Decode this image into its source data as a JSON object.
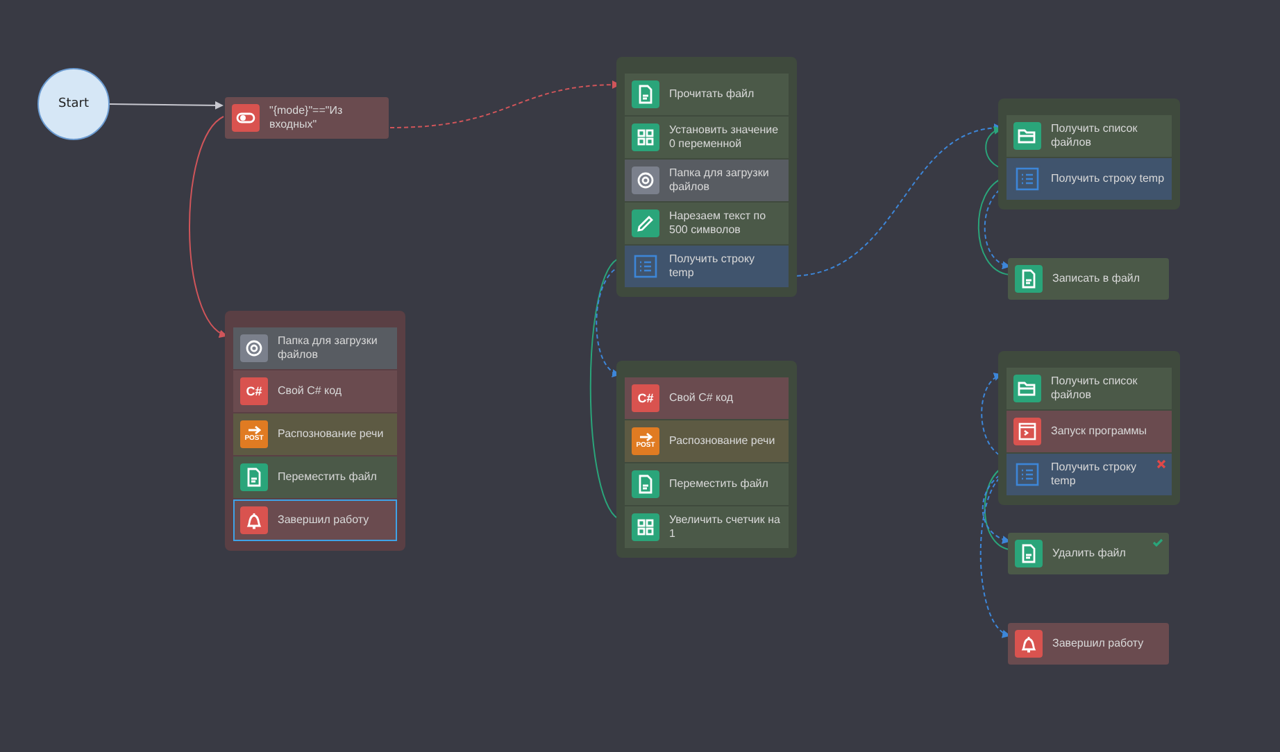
{
  "start": {
    "label": "Start"
  },
  "blocks": [
    {
      "kind": "single",
      "items": [
        {
          "kind": "toggle",
          "label": "\"{mode}\"==\"Из входных\"",
          "selected": false
        }
      ]
    },
    {
      "kind": "group",
      "color": "#5a3f44",
      "items": [
        {
          "kind": "gear",
          "label": "Папка для загрузки файлов",
          "selected": false
        },
        {
          "kind": "csharp",
          "badge": "C#",
          "label": "Свой C# код",
          "selected": false
        },
        {
          "kind": "post",
          "badge": "POST",
          "label": "Распознование речи",
          "selected": false
        },
        {
          "kind": "file",
          "label": "Переместить файл",
          "selected": false
        },
        {
          "kind": "bell",
          "label": "Завершил работу",
          "selected": true
        }
      ]
    },
    {
      "kind": "group",
      "color": "#3f4a3d",
      "items": [
        {
          "kind": "file",
          "label": "Прочитать файл",
          "selected": false
        },
        {
          "kind": "grid",
          "label": "Установить значение 0 переменной",
          "selected": false
        },
        {
          "kind": "gear",
          "label": "Папка для загрузки файлов",
          "selected": false
        },
        {
          "kind": "pencil",
          "label": "Нарезаем текст по 500 символов",
          "selected": false
        },
        {
          "kind": "list",
          "label": "Получить строку temp",
          "selected": false
        }
      ]
    },
    {
      "kind": "group",
      "color": "#3f4a3d",
      "items": [
        {
          "kind": "csharp",
          "badge": "C#",
          "label": "Свой C# код",
          "selected": false
        },
        {
          "kind": "post",
          "badge": "POST",
          "label": "Распознование речи",
          "selected": false
        },
        {
          "kind": "file",
          "label": "Переместить файл",
          "selected": false
        },
        {
          "kind": "grid",
          "label": "Увеличить счетчик на 1",
          "selected": false
        }
      ]
    },
    {
      "kind": "group",
      "color": "#3f4a3d",
      "items": [
        {
          "kind": "folder",
          "label": "Получить список файлов",
          "selected": false
        },
        {
          "kind": "list",
          "label": "Получить строку temp",
          "selected": false
        }
      ]
    },
    {
      "kind": "single",
      "items": [
        {
          "kind": "file",
          "label": "Записать в файл",
          "selected": false
        }
      ]
    },
    {
      "kind": "group",
      "color": "#3f4a3d",
      "items": [
        {
          "kind": "folder",
          "label": "Получить список файлов",
          "selected": false,
          "error": false,
          "done": false
        },
        {
          "kind": "terminal",
          "label": "Запуск программы",
          "selected": false,
          "error": false,
          "done": false
        },
        {
          "kind": "list",
          "label": "Получить строку temp",
          "selected": false,
          "error": true,
          "done": false
        }
      ]
    },
    {
      "kind": "single",
      "items": [
        {
          "kind": "file",
          "label": "Удалить файл",
          "selected": false,
          "error": false,
          "done": true
        }
      ]
    },
    {
      "kind": "single",
      "items": [
        {
          "kind": "bell",
          "label": "Завершил работу",
          "selected": false
        }
      ]
    }
  ]
}
